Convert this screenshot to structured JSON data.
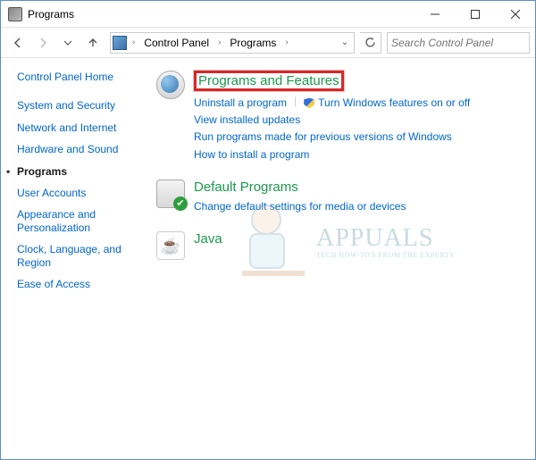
{
  "window": {
    "title": "Programs"
  },
  "breadcrumb": {
    "root": "Control Panel",
    "current": "Programs"
  },
  "search": {
    "placeholder": "Search Control Panel"
  },
  "sidebar": {
    "items": [
      {
        "label": "Control Panel Home",
        "current": false
      },
      {
        "label": "System and Security",
        "current": false
      },
      {
        "label": "Network and Internet",
        "current": false
      },
      {
        "label": "Hardware and Sound",
        "current": false
      },
      {
        "label": "Programs",
        "current": true
      },
      {
        "label": "User Accounts",
        "current": false
      },
      {
        "label": "Appearance and Personalization",
        "current": false
      },
      {
        "label": "Clock, Language, and Region",
        "current": false
      },
      {
        "label": "Ease of Access",
        "current": false
      }
    ]
  },
  "sections": {
    "programs_features": {
      "title": "Programs and Features",
      "links": {
        "uninstall": "Uninstall a program",
        "win_features": "Turn Windows features on or off",
        "installed_updates": "View installed updates",
        "compat": "Run programs made for previous versions of Windows",
        "howto": "How to install a program"
      }
    },
    "default_programs": {
      "title": "Default Programs",
      "links": {
        "change": "Change default settings for media or devices"
      }
    },
    "java": {
      "title": "Java"
    }
  },
  "watermark": {
    "brand": "APPUALS",
    "tagline": "TECH HOW-TO'S FROM THE EXPERTS"
  }
}
